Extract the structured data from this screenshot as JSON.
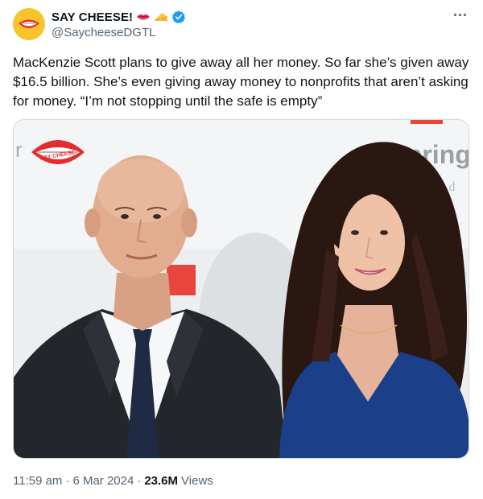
{
  "author": {
    "display_name": "SAY CHEESE!",
    "handle": "@SaycheeseDGTL",
    "verified": true,
    "badge_icons": [
      "lips-emoji",
      "cheese-emoji",
      "verified-badge-icon"
    ]
  },
  "tweet": {
    "text": "MacKenzie Scott plans to give away all her money. So far she’s given away $16.5 billion. She’s even giving away money to nonprofits that aren’t asking for money. “I’m not stopping until the safe is empty”"
  },
  "media": {
    "logo_text": "SAY CHEESE",
    "backdrop_fragments": [
      "r",
      "spring",
      "a r d",
      "er"
    ]
  },
  "meta": {
    "time": "11:59 am",
    "separator": "·",
    "date": "6 Mar 2024",
    "views_count": "23.6M",
    "views_label": "Views"
  },
  "colors": {
    "text_primary": "#0f1419",
    "text_secondary": "#536471",
    "verified_blue": "#1d9bf0",
    "backdrop": "#e9eaec",
    "accent_red": "#e8453c"
  }
}
